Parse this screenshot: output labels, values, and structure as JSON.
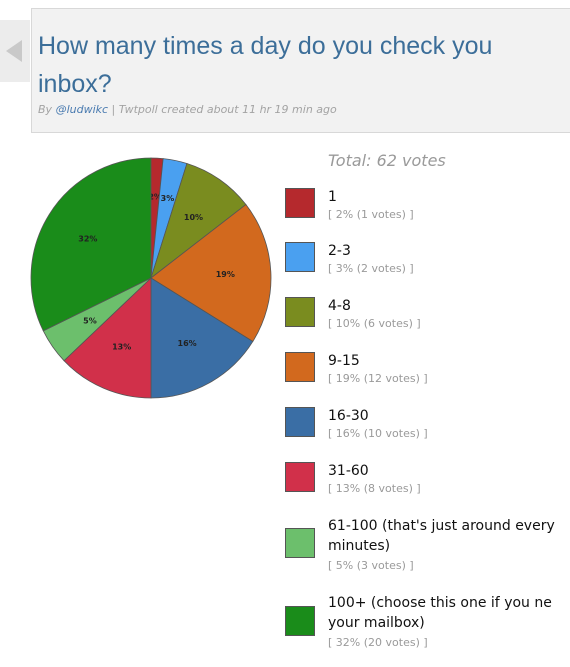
{
  "header": {
    "title_line1": "How many times a day do you check you",
    "title_line2": "inbox?",
    "byline_prefix": "By",
    "author": "@ludwikc",
    "byline_suffix": "| Twtpoll created about 11 hr 19 min ago"
  },
  "total_label": "Total: 62 votes",
  "chart_data": {
    "type": "pie",
    "total_votes": 62,
    "slices": [
      {
        "label": "1",
        "percent": 2,
        "votes": 1,
        "color": "#b5292d",
        "pct_label": "2%",
        "votes_label": "[ 2% (1 votes) ]"
      },
      {
        "label": "2-3",
        "percent": 3,
        "votes": 2,
        "color": "#4aa0f0",
        "pct_label": "3%",
        "votes_label": "[ 3% (2 votes) ]"
      },
      {
        "label": "4-8",
        "percent": 10,
        "votes": 6,
        "color": "#7a8c1f",
        "pct_label": "10%",
        "votes_label": "[ 10% (6 votes) ]"
      },
      {
        "label": "9-15",
        "percent": 19,
        "votes": 12,
        "color": "#d2691e",
        "pct_label": "19%",
        "votes_label": "[ 19% (12 votes) ]"
      },
      {
        "label": "16-30",
        "percent": 16,
        "votes": 10,
        "color": "#3a6ea5",
        "pct_label": "16%",
        "votes_label": "[ 16% (10 votes) ]"
      },
      {
        "label": "31-60",
        "percent": 13,
        "votes": 8,
        "color": "#d1304a",
        "pct_label": "13%",
        "votes_label": "[ 13% (8 votes) ]"
      },
      {
        "label_line1": "61-100 (that's just around every",
        "label_line2": "minutes)",
        "percent": 5,
        "votes": 3,
        "color": "#6cbf6c",
        "pct_label": "5%",
        "votes_label": "[ 5% (3 votes) ]"
      },
      {
        "label_line1": "100+ (choose this one if you ne",
        "label_line2": "your mailbox)",
        "percent": 32,
        "votes": 20,
        "color": "#1a8c1a",
        "pct_label": "32%",
        "votes_label": "[ 32% (20 votes) ]"
      }
    ]
  }
}
